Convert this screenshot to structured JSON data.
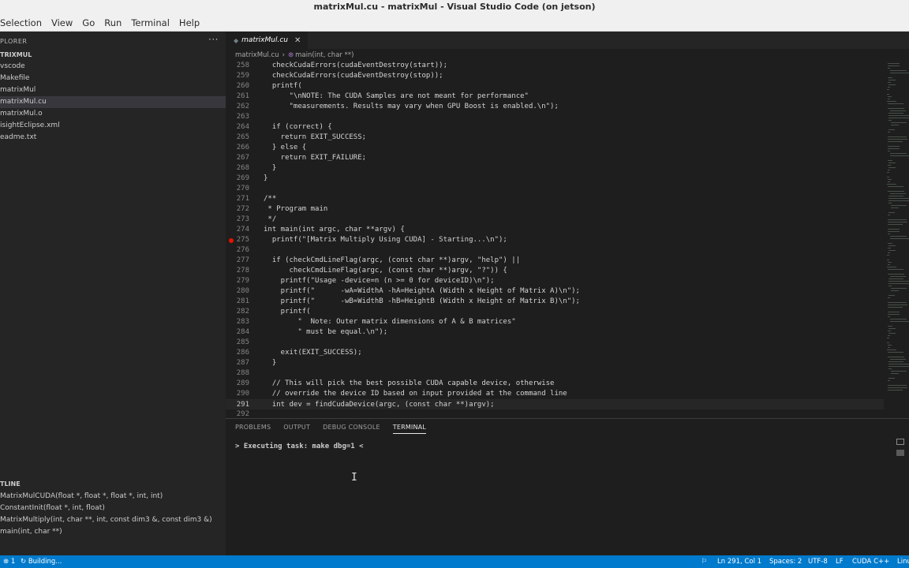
{
  "window": {
    "title": "matrixMul.cu - matrixMul - Visual Studio Code (on jetson)"
  },
  "menu": [
    "Selection",
    "View",
    "Go",
    "Run",
    "Terminal",
    "Help"
  ],
  "sidebar": {
    "header": "PLORER",
    "more_glyph": "···",
    "section": "TRIXMUL",
    "files": [
      "vscode",
      "Makefile",
      "matrixMul",
      "matrixMul.cu",
      "matrixMul.o",
      "isightEclipse.xml",
      "eadme.txt"
    ],
    "active_file_index": 3
  },
  "outline": {
    "title": "TLINE",
    "items": [
      "MatrixMulCUDA(float *, float *, float *, int, int)",
      "ConstantInit(float *, int, float)",
      "MatrixMultiply(int, char **, int, const dim3 &, const dim3 &)",
      "main(int, char **)"
    ]
  },
  "tab": {
    "label": "matrixMul.cu",
    "close_glyph": "✕"
  },
  "breadcrumb": {
    "file": "matrixMul.cu",
    "symbol": "main(int, char **)"
  },
  "editor": {
    "current_line": 291,
    "breakpoint_line": 275,
    "lines": [
      {
        "n": "258",
        "t": "  checkCudaErrors(cudaEventDestroy(start));"
      },
      {
        "n": "259",
        "t": "  checkCudaErrors(cudaEventDestroy(stop));"
      },
      {
        "n": "260",
        "t": "  printf("
      },
      {
        "n": "261",
        "t": "      \"\\nNOTE: The CUDA Samples are not meant for performance\""
      },
      {
        "n": "262",
        "t": "      \"measurements. Results may vary when GPU Boost is enabled.\\n\");"
      },
      {
        "n": "263",
        "t": ""
      },
      {
        "n": "264",
        "t": "  if (correct) {"
      },
      {
        "n": "265",
        "t": "    return EXIT_SUCCESS;"
      },
      {
        "n": "266",
        "t": "  } else {"
      },
      {
        "n": "267",
        "t": "    return EXIT_FAILURE;"
      },
      {
        "n": "268",
        "t": "  }"
      },
      {
        "n": "269",
        "t": "}"
      },
      {
        "n": "270",
        "t": ""
      },
      {
        "n": "271",
        "t": "/**"
      },
      {
        "n": "272",
        "t": " * Program main"
      },
      {
        "n": "273",
        "t": " */"
      },
      {
        "n": "274",
        "t": "int main(int argc, char **argv) {"
      },
      {
        "n": "275",
        "t": "  printf(\"[Matrix Multiply Using CUDA] - Starting...\\n\");"
      },
      {
        "n": "276",
        "t": ""
      },
      {
        "n": "277",
        "t": "  if (checkCmdLineFlag(argc, (const char **)argv, \"help\") ||"
      },
      {
        "n": "278",
        "t": "      checkCmdLineFlag(argc, (const char **)argv, \"?\")) {"
      },
      {
        "n": "279",
        "t": "    printf(\"Usage -device=n (n >= 0 for deviceID)\\n\");"
      },
      {
        "n": "280",
        "t": "    printf(\"      -wA=WidthA -hA=HeightA (Width x Height of Matrix A)\\n\");"
      },
      {
        "n": "281",
        "t": "    printf(\"      -wB=WidthB -hB=HeightB (Width x Height of Matrix B)\\n\");"
      },
      {
        "n": "282",
        "t": "    printf("
      },
      {
        "n": "283",
        "t": "        \"  Note: Outer matrix dimensions of A & B matrices\""
      },
      {
        "n": "284",
        "t": "        \" must be equal.\\n\");"
      },
      {
        "n": "285",
        "t": ""
      },
      {
        "n": "286",
        "t": "    exit(EXIT_SUCCESS);"
      },
      {
        "n": "287",
        "t": "  }"
      },
      {
        "n": "288",
        "t": ""
      },
      {
        "n": "289",
        "t": "  // This will pick the best possible CUDA capable device, otherwise"
      },
      {
        "n": "290",
        "t": "  // override the device ID based on input provided at the command line"
      },
      {
        "n": "291",
        "t": "  int dev = findCudaDevice(argc, (const char **)argv);"
      },
      {
        "n": "292",
        "t": ""
      }
    ]
  },
  "panel": {
    "tabs": [
      "PROBLEMS",
      "OUTPUT",
      "DEBUG CONSOLE",
      "TERMINAL"
    ],
    "active_tab": "TERMINAL",
    "terminal_text": "> Executing task: make dbg=1 <"
  },
  "status": {
    "left_number": "1",
    "building": "Building...",
    "position": "Ln 291, Col 1",
    "spaces": "Spaces: 2",
    "encoding": "UTF-8",
    "eol": "LF",
    "language": "CUDA C++",
    "platform": "Linu"
  },
  "colors": {
    "accent": "#007acc",
    "background": "#1e1e1e",
    "sidebar": "#252526"
  }
}
